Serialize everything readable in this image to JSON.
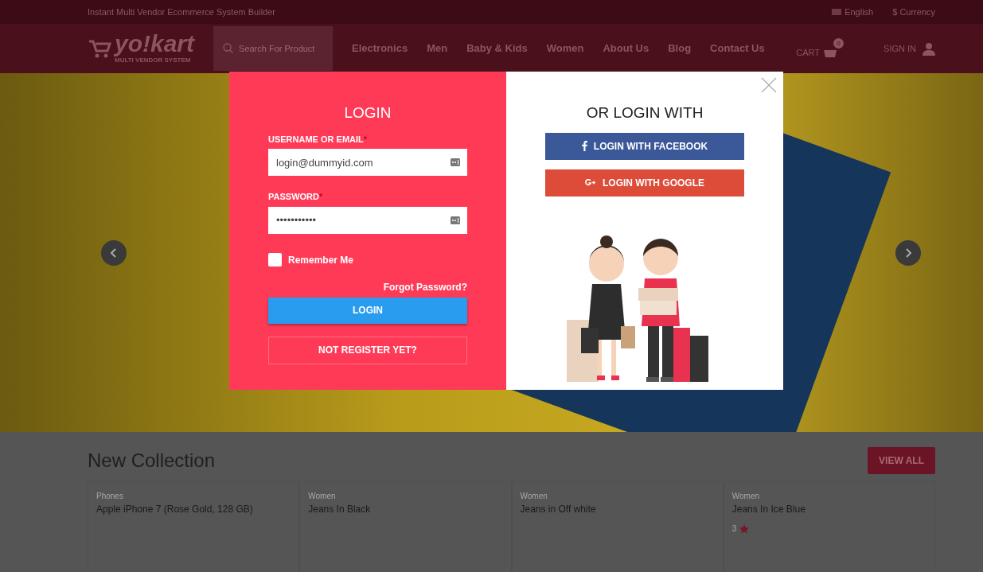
{
  "top_bar": {
    "tagline": "Instant Multi Vendor Ecommerce System Builder",
    "language": "English",
    "currency": "$ Currency"
  },
  "header": {
    "logo": {
      "name": "yo!kart",
      "subtitle": "MULTI VENDOR SYSTEM"
    },
    "search": {
      "placeholder": "Search For Product"
    },
    "nav": [
      "Electronics",
      "Men",
      "Baby & Kids",
      "Women",
      "About Us",
      "Blog",
      "Contact Us"
    ],
    "cart": {
      "label": "CART",
      "count": "0"
    },
    "sign_in": "SIGN IN"
  },
  "new_collection": {
    "title": "New Collection",
    "view_all": "VIEW ALL",
    "products": [
      {
        "category": "Phones",
        "name": "Apple iPhone 7 (Rose Gold, 128 GB)"
      },
      {
        "category": "Women",
        "name": "Jeans In Black"
      },
      {
        "category": "Women",
        "name": "Jeans in Off white"
      },
      {
        "category": "Women",
        "name": "Jeans In Ice Blue",
        "rating": "3"
      }
    ]
  },
  "login_modal": {
    "title": "LOGIN",
    "fields": [
      {
        "label": "USERNAME OR EMAIL",
        "required_mark": "*",
        "value": "login@dummyid.com"
      },
      {
        "label": "PASSWORD",
        "required_mark": "*",
        "value": "•••••••••••"
      }
    ],
    "remember": {
      "label": "Remember Me",
      "checked": false
    },
    "forgot": "Forgot Password?",
    "login_button": "LOGIN",
    "register_button": "NOT REGISTER YET?",
    "social_title": "OR LOGIN WITH",
    "social_buttons": [
      {
        "kind": "facebook",
        "label": "LOGIN WITH FACEBOOK"
      },
      {
        "kind": "google",
        "label": "LOGIN WITH GOOGLE"
      }
    ]
  }
}
